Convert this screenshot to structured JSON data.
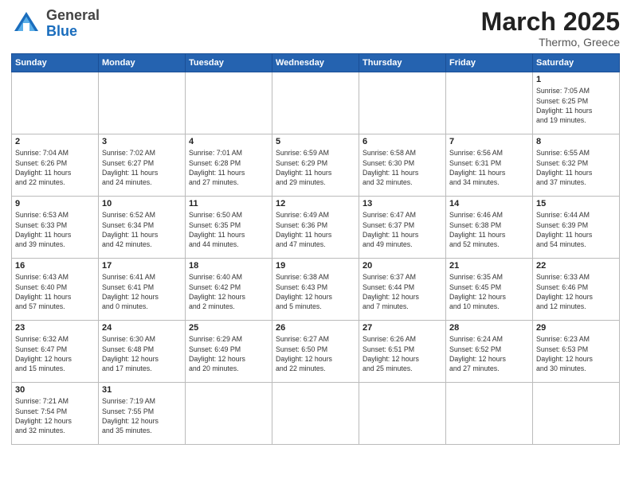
{
  "header": {
    "logo_general": "General",
    "logo_blue": "Blue",
    "title": "March 2025",
    "location": "Thermo, Greece"
  },
  "weekdays": [
    "Sunday",
    "Monday",
    "Tuesday",
    "Wednesday",
    "Thursday",
    "Friday",
    "Saturday"
  ],
  "weeks": [
    [
      {
        "day": "",
        "info": ""
      },
      {
        "day": "",
        "info": ""
      },
      {
        "day": "",
        "info": ""
      },
      {
        "day": "",
        "info": ""
      },
      {
        "day": "",
        "info": ""
      },
      {
        "day": "",
        "info": ""
      },
      {
        "day": "1",
        "info": "Sunrise: 7:05 AM\nSunset: 6:25 PM\nDaylight: 11 hours\nand 19 minutes."
      }
    ],
    [
      {
        "day": "2",
        "info": "Sunrise: 7:04 AM\nSunset: 6:26 PM\nDaylight: 11 hours\nand 22 minutes."
      },
      {
        "day": "3",
        "info": "Sunrise: 7:02 AM\nSunset: 6:27 PM\nDaylight: 11 hours\nand 24 minutes."
      },
      {
        "day": "4",
        "info": "Sunrise: 7:01 AM\nSunset: 6:28 PM\nDaylight: 11 hours\nand 27 minutes."
      },
      {
        "day": "5",
        "info": "Sunrise: 6:59 AM\nSunset: 6:29 PM\nDaylight: 11 hours\nand 29 minutes."
      },
      {
        "day": "6",
        "info": "Sunrise: 6:58 AM\nSunset: 6:30 PM\nDaylight: 11 hours\nand 32 minutes."
      },
      {
        "day": "7",
        "info": "Sunrise: 6:56 AM\nSunset: 6:31 PM\nDaylight: 11 hours\nand 34 minutes."
      },
      {
        "day": "8",
        "info": "Sunrise: 6:55 AM\nSunset: 6:32 PM\nDaylight: 11 hours\nand 37 minutes."
      }
    ],
    [
      {
        "day": "9",
        "info": "Sunrise: 6:53 AM\nSunset: 6:33 PM\nDaylight: 11 hours\nand 39 minutes."
      },
      {
        "day": "10",
        "info": "Sunrise: 6:52 AM\nSunset: 6:34 PM\nDaylight: 11 hours\nand 42 minutes."
      },
      {
        "day": "11",
        "info": "Sunrise: 6:50 AM\nSunset: 6:35 PM\nDaylight: 11 hours\nand 44 minutes."
      },
      {
        "day": "12",
        "info": "Sunrise: 6:49 AM\nSunset: 6:36 PM\nDaylight: 11 hours\nand 47 minutes."
      },
      {
        "day": "13",
        "info": "Sunrise: 6:47 AM\nSunset: 6:37 PM\nDaylight: 11 hours\nand 49 minutes."
      },
      {
        "day": "14",
        "info": "Sunrise: 6:46 AM\nSunset: 6:38 PM\nDaylight: 11 hours\nand 52 minutes."
      },
      {
        "day": "15",
        "info": "Sunrise: 6:44 AM\nSunset: 6:39 PM\nDaylight: 11 hours\nand 54 minutes."
      }
    ],
    [
      {
        "day": "16",
        "info": "Sunrise: 6:43 AM\nSunset: 6:40 PM\nDaylight: 11 hours\nand 57 minutes."
      },
      {
        "day": "17",
        "info": "Sunrise: 6:41 AM\nSunset: 6:41 PM\nDaylight: 12 hours\nand 0 minutes."
      },
      {
        "day": "18",
        "info": "Sunrise: 6:40 AM\nSunset: 6:42 PM\nDaylight: 12 hours\nand 2 minutes."
      },
      {
        "day": "19",
        "info": "Sunrise: 6:38 AM\nSunset: 6:43 PM\nDaylight: 12 hours\nand 5 minutes."
      },
      {
        "day": "20",
        "info": "Sunrise: 6:37 AM\nSunset: 6:44 PM\nDaylight: 12 hours\nand 7 minutes."
      },
      {
        "day": "21",
        "info": "Sunrise: 6:35 AM\nSunset: 6:45 PM\nDaylight: 12 hours\nand 10 minutes."
      },
      {
        "day": "22",
        "info": "Sunrise: 6:33 AM\nSunset: 6:46 PM\nDaylight: 12 hours\nand 12 minutes."
      }
    ],
    [
      {
        "day": "23",
        "info": "Sunrise: 6:32 AM\nSunset: 6:47 PM\nDaylight: 12 hours\nand 15 minutes."
      },
      {
        "day": "24",
        "info": "Sunrise: 6:30 AM\nSunset: 6:48 PM\nDaylight: 12 hours\nand 17 minutes."
      },
      {
        "day": "25",
        "info": "Sunrise: 6:29 AM\nSunset: 6:49 PM\nDaylight: 12 hours\nand 20 minutes."
      },
      {
        "day": "26",
        "info": "Sunrise: 6:27 AM\nSunset: 6:50 PM\nDaylight: 12 hours\nand 22 minutes."
      },
      {
        "day": "27",
        "info": "Sunrise: 6:26 AM\nSunset: 6:51 PM\nDaylight: 12 hours\nand 25 minutes."
      },
      {
        "day": "28",
        "info": "Sunrise: 6:24 AM\nSunset: 6:52 PM\nDaylight: 12 hours\nand 27 minutes."
      },
      {
        "day": "29",
        "info": "Sunrise: 6:23 AM\nSunset: 6:53 PM\nDaylight: 12 hours\nand 30 minutes."
      }
    ],
    [
      {
        "day": "30",
        "info": "Sunrise: 7:21 AM\nSunset: 7:54 PM\nDaylight: 12 hours\nand 32 minutes."
      },
      {
        "day": "31",
        "info": "Sunrise: 7:19 AM\nSunset: 7:55 PM\nDaylight: 12 hours\nand 35 minutes."
      },
      {
        "day": "",
        "info": ""
      },
      {
        "day": "",
        "info": ""
      },
      {
        "day": "",
        "info": ""
      },
      {
        "day": "",
        "info": ""
      },
      {
        "day": "",
        "info": ""
      }
    ]
  ]
}
